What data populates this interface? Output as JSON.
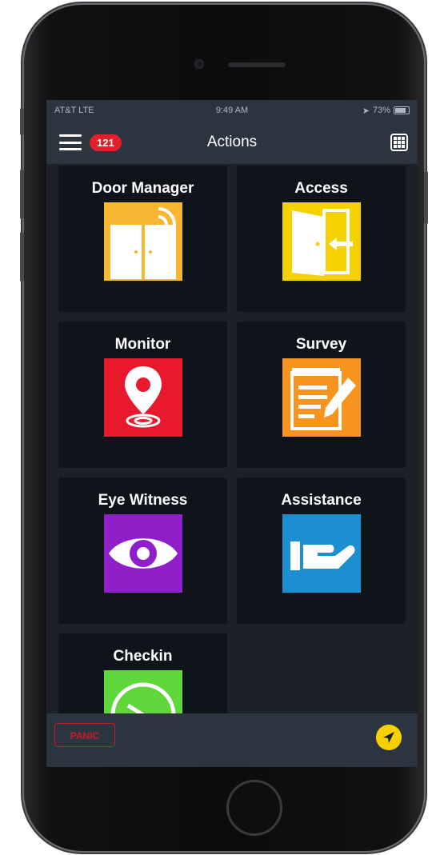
{
  "status_bar": {
    "carrier": "AT&T  LTE",
    "time": "9:49 AM",
    "battery": "73%"
  },
  "header": {
    "title": "Actions",
    "notification_count": "121",
    "menu_icon": "hamburger-icon",
    "grid_icon": "grid-icon"
  },
  "actions": [
    {
      "label": "Door Manager",
      "icon": "door-manager-icon",
      "color": "#f7b733"
    },
    {
      "label": "Access",
      "icon": "access-door-icon",
      "color": "#f6d100"
    },
    {
      "label": "Monitor",
      "icon": "location-pin-icon",
      "color": "#e8192c"
    },
    {
      "label": "Survey",
      "icon": "notepad-pencil-icon",
      "color": "#f7941d"
    },
    {
      "label": "Eye Witness",
      "icon": "eye-icon",
      "color": "#8e1fc9"
    },
    {
      "label": "Assistance",
      "icon": "helping-hand-icon",
      "color": "#1b8fd0"
    },
    {
      "label": "Checkin",
      "icon": "clock-icon",
      "color": "#5fd63a"
    }
  ],
  "footer": {
    "panic_label": "PANIC",
    "locate_icon": "navigation-arrow-icon",
    "panic_color": "#c81e28",
    "locate_color": "#f6d100"
  }
}
